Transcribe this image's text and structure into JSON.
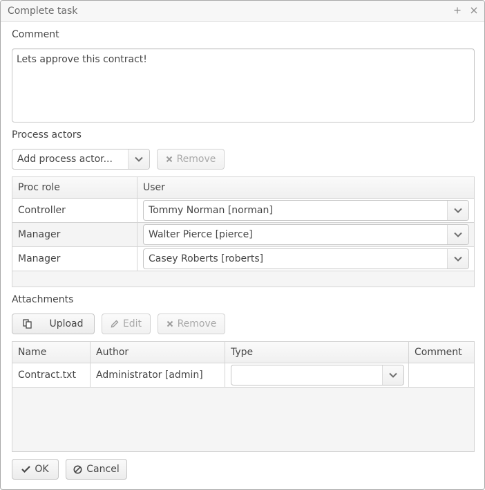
{
  "window": {
    "title": "Complete task",
    "maximize_icon": "plus-icon",
    "close_icon": "close-icon"
  },
  "comment": {
    "label": "Comment",
    "value": "Lets approve this contract!"
  },
  "process_actors": {
    "label": "Process actors",
    "add_combo_text": "Add process actor...",
    "remove_label": "Remove",
    "columns": [
      "Proc role",
      "User"
    ],
    "rows": [
      {
        "role": "Controller",
        "user": "Tommy Norman [norman]"
      },
      {
        "role": "Manager",
        "user": "Walter Pierce [pierce]"
      },
      {
        "role": "Manager",
        "user": "Casey Roberts [roberts]"
      }
    ]
  },
  "attachments": {
    "label": "Attachments",
    "upload_label": "Upload",
    "edit_label": "Edit",
    "remove_label": "Remove",
    "columns": [
      "Name",
      "Author",
      "Type",
      "Comment"
    ],
    "rows": [
      {
        "name": "Contract.txt",
        "author": "Administrator [admin]",
        "type": "",
        "comment": ""
      }
    ]
  },
  "footer": {
    "ok_label": "OK",
    "cancel_label": "Cancel"
  }
}
